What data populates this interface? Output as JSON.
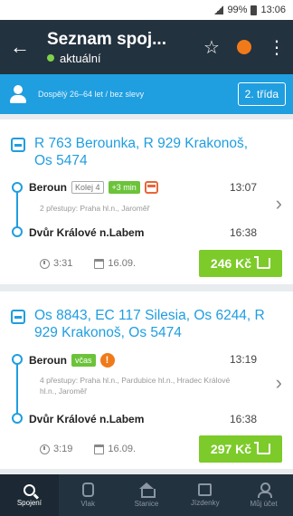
{
  "statusbar": {
    "battery": "99%",
    "time": "13:06"
  },
  "header": {
    "title": "Seznam spoj...",
    "status": "aktuální"
  },
  "filter": {
    "passenger": "Dospělý 26–64 let / bez slevy",
    "travel_class": "2. třída"
  },
  "connections": [
    {
      "name": "R 763 Berounka, R 929 Krakonoš, Os 5474",
      "from_station": "Beroun",
      "track_label": "Kolej 4",
      "wait_label": "+3 min",
      "from_time": "13:07",
      "transfers": "2 přestupy: Praha hl.n., Jaroměř",
      "to_station": "Dvůr Králové n.Labem",
      "to_time": "16:38",
      "duration": "3:31",
      "date": "16.09.",
      "price": "246 Kč"
    },
    {
      "name": "Os 8843, EC 117 Silesia, Os 6244, R 929 Krakonoš, Os 5474",
      "from_station": "Beroun",
      "wait_label": "včas",
      "alert_symbol": "!",
      "from_time": "13:19",
      "transfers": "4 přestupy: Praha hl.n., Pardubice hl.n., Hradec Králové hl.n., Jaroměř",
      "to_station": "Dvůr Králové n.Labem",
      "to_time": "16:38",
      "duration": "3:19",
      "date": "16.09.",
      "price": "297 Kč"
    }
  ],
  "bottomnav": [
    {
      "label": "Spojení",
      "icon": "search-icon",
      "active": true
    },
    {
      "label": "Vlak",
      "icon": "train-icon"
    },
    {
      "label": "Stanice",
      "icon": "home-icon"
    },
    {
      "label": "Jízdenky",
      "icon": "ticket-icon"
    },
    {
      "label": "Můj účet",
      "icon": "user-icon"
    }
  ],
  "colors": {
    "appbar": "#23323f",
    "accent": "#1f9ee0",
    "price": "#7dcb2a",
    "alert": "#f07a1a"
  }
}
